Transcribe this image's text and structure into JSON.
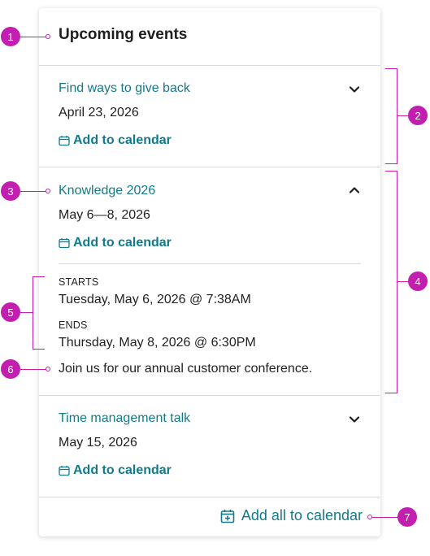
{
  "card": {
    "title": "Upcoming events"
  },
  "events": [
    {
      "title": "Find ways to give back",
      "date": "April 23, 2026",
      "calendar_label": "Add to calendar",
      "expanded": false
    },
    {
      "title": "Knowledge 2026",
      "date": "May 6—8, 2026",
      "calendar_label": "Add to calendar",
      "expanded": true,
      "starts_label": "STARTS",
      "starts_value": "Tuesday, May 6, 2026 @ 7:38AM",
      "ends_label": "ENDS",
      "ends_value": "Thursday, May 8, 2026 @ 6:30PM",
      "description": "Join us for our annual customer conference."
    },
    {
      "title": "Time management talk",
      "date": "May 15, 2026",
      "calendar_label": "Add to calendar",
      "expanded": false
    }
  ],
  "footer": {
    "add_all_label": "Add all to calendar"
  },
  "annotations": [
    "1",
    "2",
    "3",
    "4",
    "5",
    "6",
    "7"
  ],
  "colors": {
    "accent": "#127a8a",
    "annotation": "#c21fb0",
    "divider": "#d9d9d9"
  },
  "icons": {
    "collapsed": "chevron-down-icon",
    "expanded": "chevron-up-icon",
    "calendar": "calendar-icon",
    "calendar_add": "calendar-add-icon"
  }
}
